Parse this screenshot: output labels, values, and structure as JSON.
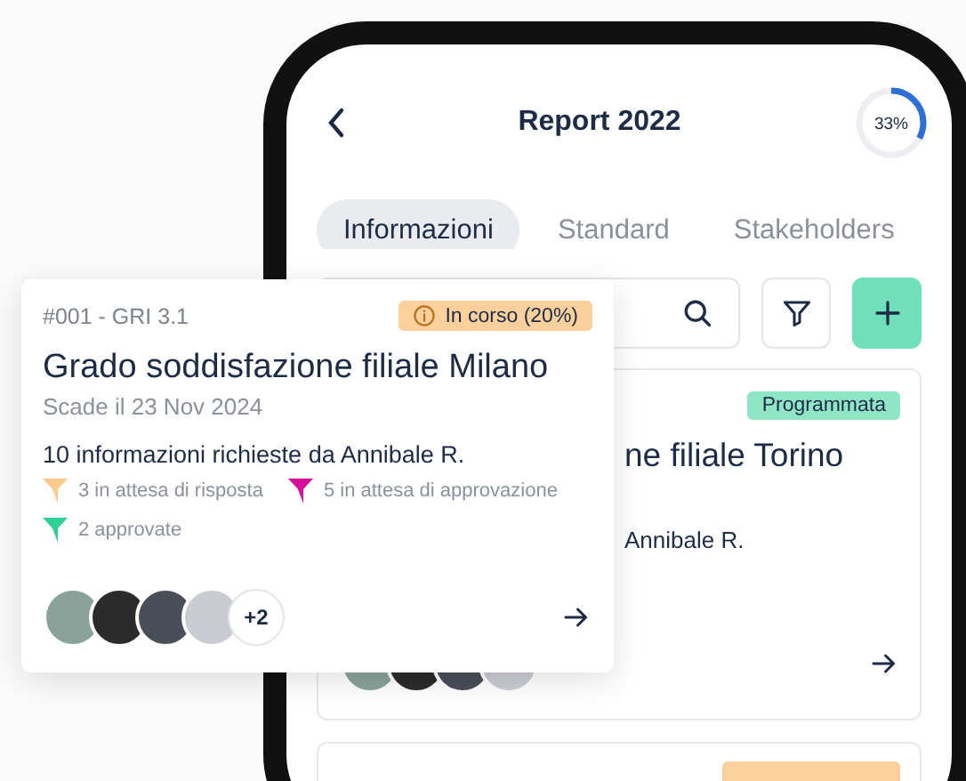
{
  "header": {
    "title": "Report 2022",
    "progress": {
      "level": 0.33,
      "label": "33%"
    }
  },
  "tabs": [
    {
      "label": "Informazioni",
      "selected": true
    },
    {
      "label": "Standard",
      "selected": false
    },
    {
      "label": "Stakeholders",
      "selected": false
    }
  ],
  "background_card": {
    "badge": {
      "label": "Programmata",
      "kind": "scheduled"
    },
    "title": "ne filiale Torino",
    "requester": "Annibale R."
  },
  "floating_card": {
    "code": "#001 - GRI 3.1",
    "badge": {
      "label": "In corso (20%)",
      "kind": "in_progress"
    },
    "title": "Grado soddisfazione filiale Milano",
    "due": "Scade il 23 Nov 2024",
    "requests": "10 informazioni richieste da Annibale R.",
    "statuses": [
      {
        "label": "3 in attesa di risposta",
        "color": "#fcc98f"
      },
      {
        "label": "5 in attesa di approvazione",
        "color": "#d6109a"
      },
      {
        "label": "2 approvate",
        "color": "#2fcf95"
      }
    ],
    "avatars_more": "+2"
  }
}
